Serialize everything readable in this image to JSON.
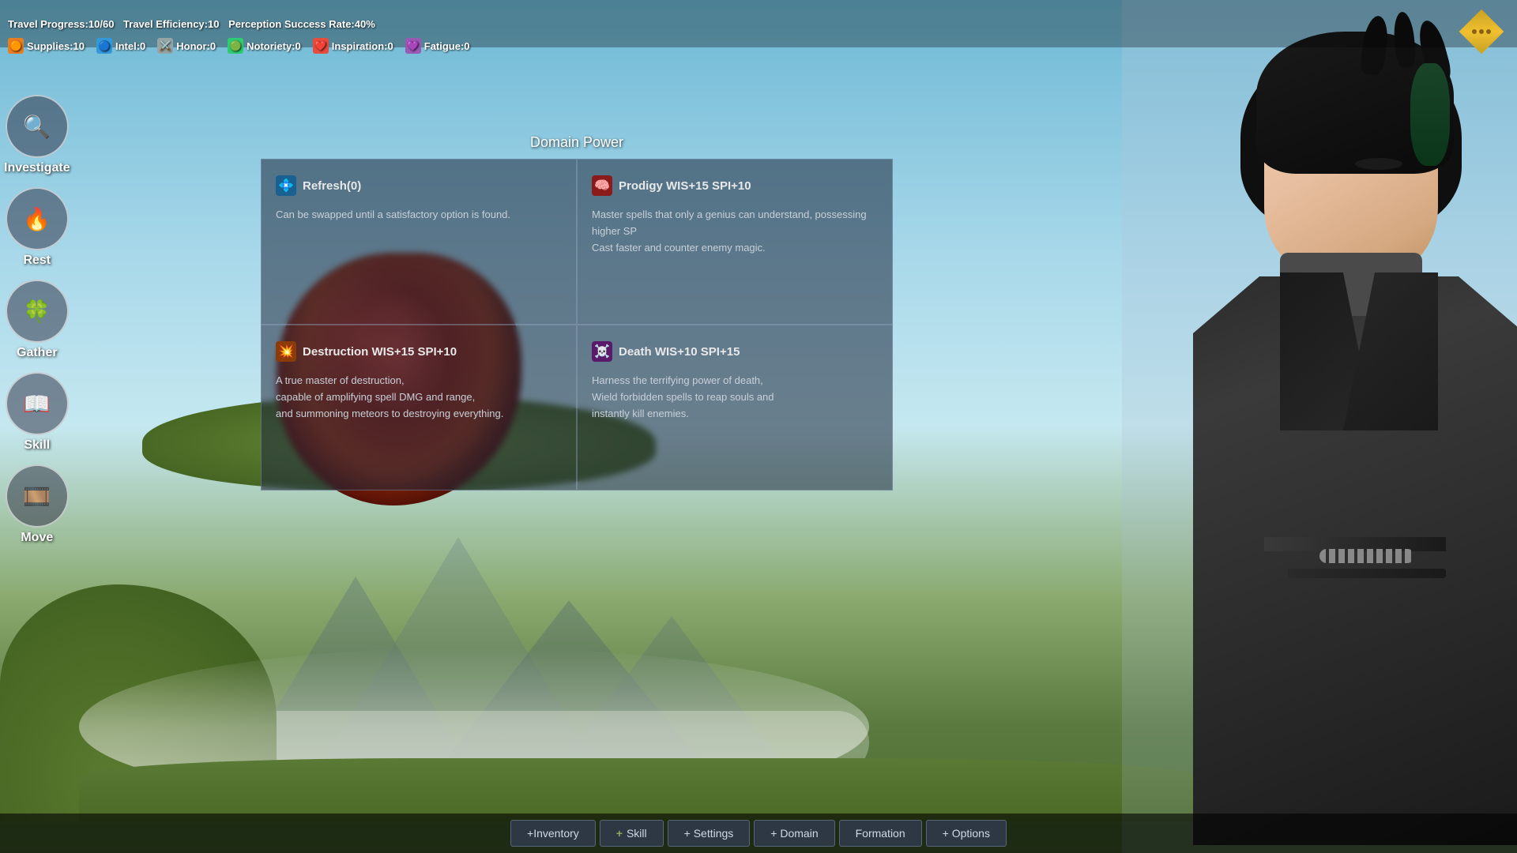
{
  "hud": {
    "progress_label": "Travel Progress:10/60",
    "efficiency_label": "Travel Efficiency:10",
    "perception_label": "Perception Success Rate:40%",
    "stats": [
      {
        "id": "supplies",
        "icon": "🟠",
        "label": "Supplies:10",
        "type": "supplies"
      },
      {
        "id": "intel",
        "icon": "🔵",
        "label": "Intel:0",
        "type": "intel"
      },
      {
        "id": "honor",
        "icon": "⚔️",
        "label": "Honor:0",
        "type": "honor"
      },
      {
        "id": "notoriety",
        "icon": "🟢",
        "label": "Notoriety:0",
        "type": "notoriety"
      },
      {
        "id": "inspiration",
        "icon": "❤️",
        "label": "Inspiration:0",
        "type": "inspiration"
      },
      {
        "id": "fatigue",
        "icon": "💜",
        "label": "Fatigue:0",
        "type": "fatigue"
      }
    ]
  },
  "sidebar": {
    "actions": [
      {
        "id": "investigate",
        "icon": "🔍",
        "label": "Investigate"
      },
      {
        "id": "rest",
        "icon": "🔥",
        "label": "Rest"
      },
      {
        "id": "gather",
        "icon": "🍀",
        "label": "Gather"
      },
      {
        "id": "skill",
        "icon": "📖",
        "label": "Skill"
      },
      {
        "id": "move",
        "icon": "🎞️",
        "label": "Move"
      }
    ]
  },
  "domain_power": {
    "title": "Domain Power",
    "cards": [
      {
        "id": "refresh",
        "icon": "💠",
        "name": "Refresh(0)",
        "description": "Can be swapped until a satisfactory option is found.",
        "icon_color": "#3498db"
      },
      {
        "id": "prodigy",
        "icon": "🧠",
        "name": "Prodigy WIS+15 SPI+10",
        "description": "Master spells that only a genius can understand, possessing higher SP\nCast faster and counter enemy magic.",
        "icon_color": "#e74c3c"
      },
      {
        "id": "destruction",
        "icon": "💥",
        "name": "Destruction WIS+15 SPI+10",
        "description": "A true master of destruction,\ncapable of amplifying spell DMG and range,\nand summoning meteors to destroying everything.",
        "icon_color": "#e67e22"
      },
      {
        "id": "death",
        "icon": "☠️",
        "name": "Death WIS+10 SPI+15",
        "description": "Harness the terrifying power of death,\nWield forbidden spells to reap souls and\ninstantly kill enemies.",
        "icon_color": "#9b59b6"
      }
    ]
  },
  "toolbar": {
    "buttons": [
      {
        "id": "inventory",
        "label": "+Inventory"
      },
      {
        "id": "skill-sep",
        "label": "+"
      },
      {
        "id": "skill",
        "label": "Skill"
      },
      {
        "id": "settings-sep",
        "label": "+"
      },
      {
        "id": "settings",
        "label": "Settings"
      },
      {
        "id": "domain-sep",
        "label": "+"
      },
      {
        "id": "domain",
        "label": "Domain"
      },
      {
        "id": "formation",
        "label": "Formation"
      },
      {
        "id": "options-sep",
        "label": "+"
      },
      {
        "id": "options",
        "label": "Options"
      }
    ],
    "inventory_label": "+Inventory",
    "skill_label": "Skill",
    "settings_label": "+ Settings",
    "domain_label": "+ Domain",
    "formation_label": "Formation",
    "options_label": "+ Options"
  },
  "colors": {
    "accent": "#3498db",
    "panel_bg": "rgba(30,40,60,0.55)",
    "text_primary": "#e8e8e8",
    "text_secondary": "#c8d0d8",
    "border": "rgba(150,170,200,0.4)"
  }
}
